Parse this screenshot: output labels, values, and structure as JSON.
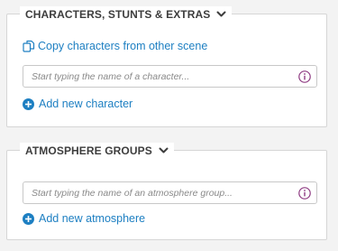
{
  "characters_section": {
    "title": "CHARACTERS, STUNTS & EXTRAS",
    "copy_link": "Copy characters from other scene",
    "placeholder": "Start typing the name of a character...",
    "add_link": "Add new character"
  },
  "atmosphere_section": {
    "title": "ATMOSPHERE GROUPS",
    "placeholder": "Start typing the name of an atmosphere group...",
    "add_link": "Add new atmosphere"
  },
  "colors": {
    "link": "#1d7fc2",
    "info_icon": "#8e3b82",
    "heading": "#3d3d3d",
    "border": "#d6d6d6"
  },
  "icons": [
    "chevron-down-icon",
    "copy-icon",
    "info-icon",
    "plus-circle-icon"
  ]
}
